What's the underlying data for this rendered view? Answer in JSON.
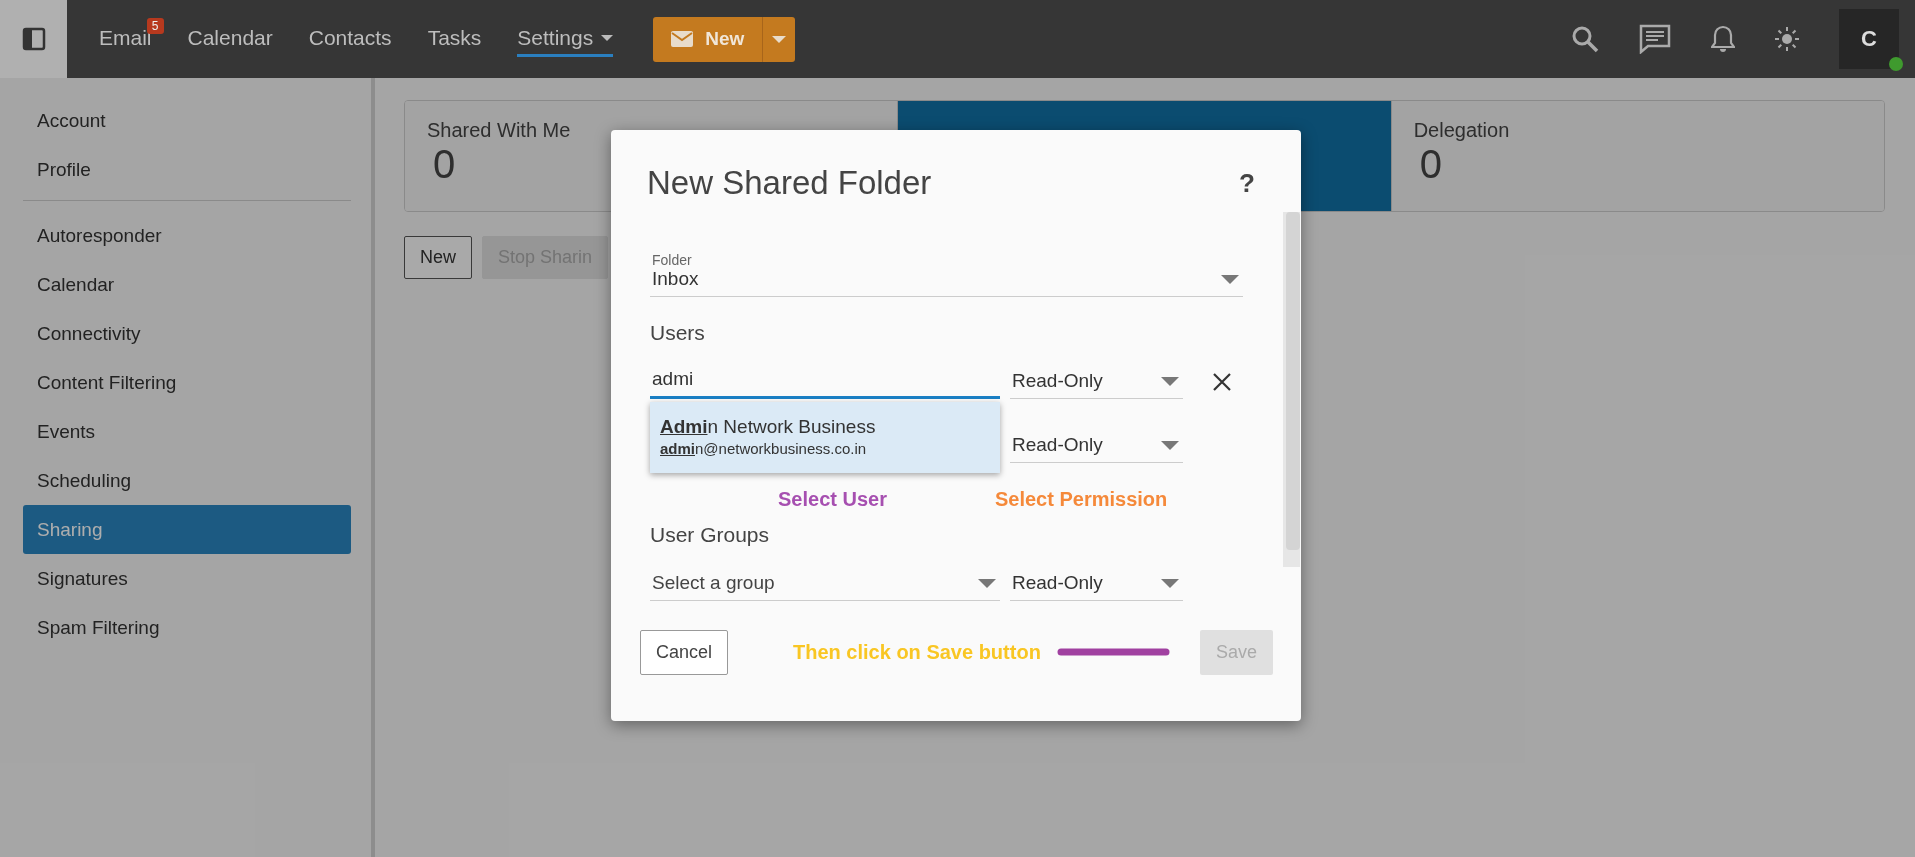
{
  "topbar": {
    "nav": [
      {
        "label": "Email",
        "badge": "5",
        "selected": false,
        "menu": false
      },
      {
        "label": "Calendar",
        "selected": false,
        "menu": false
      },
      {
        "label": "Contacts",
        "selected": false,
        "menu": false
      },
      {
        "label": "Tasks",
        "selected": false,
        "menu": false
      },
      {
        "label": "Settings",
        "selected": true,
        "menu": true
      }
    ],
    "new_button": "New",
    "avatar": "C",
    "online": true
  },
  "sidebar": {
    "groups": [
      [
        {
          "label": "Account",
          "selected": false
        },
        {
          "label": "Profile",
          "selected": false
        }
      ],
      [
        {
          "label": "Autoresponder",
          "selected": false
        },
        {
          "label": "Calendar",
          "selected": false
        },
        {
          "label": "Connectivity",
          "selected": false
        },
        {
          "label": "Content Filtering",
          "selected": false
        },
        {
          "label": "Events",
          "selected": false
        },
        {
          "label": "Scheduling",
          "selected": false
        },
        {
          "label": "Sharing",
          "selected": true
        },
        {
          "label": "Signatures",
          "selected": false
        },
        {
          "label": "Spam Filtering",
          "selected": false
        }
      ]
    ]
  },
  "summary_tabs": [
    {
      "label": "Shared With Me",
      "count": "0",
      "selected": false
    },
    {
      "selected": true
    },
    {
      "label": "Delegation",
      "count": "0",
      "selected": false
    }
  ],
  "toolbar": [
    {
      "label": "New",
      "disabled": false
    },
    {
      "label": "Stop Sharin",
      "disabled": true
    }
  ],
  "dialog": {
    "title": "New Shared Folder",
    "help": "?",
    "folder": {
      "label": "Folder",
      "value": "Inbox"
    },
    "users_heading": "Users",
    "users": [
      {
        "value": "admi",
        "permission": "Read-Only",
        "focused": true,
        "removable": true
      },
      {
        "permission": "Read-Only",
        "removable": false
      }
    ],
    "suggestions": [
      {
        "name": "**Admi**n Network Business",
        "email": "**admi**n@networkbusiness.co.in"
      }
    ],
    "hints": [
      {
        "text": "Select User",
        "color": "#a64fb0"
      },
      {
        "text": "Select Permission",
        "color": "#f5893a"
      }
    ],
    "groups_heading": "User Groups",
    "group": {
      "placeholder": "Select a group",
      "permission": "Read-Only"
    },
    "cancel": "Cancel",
    "save": {
      "label": "Save",
      "disabled": true
    },
    "save_hint": {
      "text": "Then click on Save button",
      "color": "#f9c623"
    }
  }
}
